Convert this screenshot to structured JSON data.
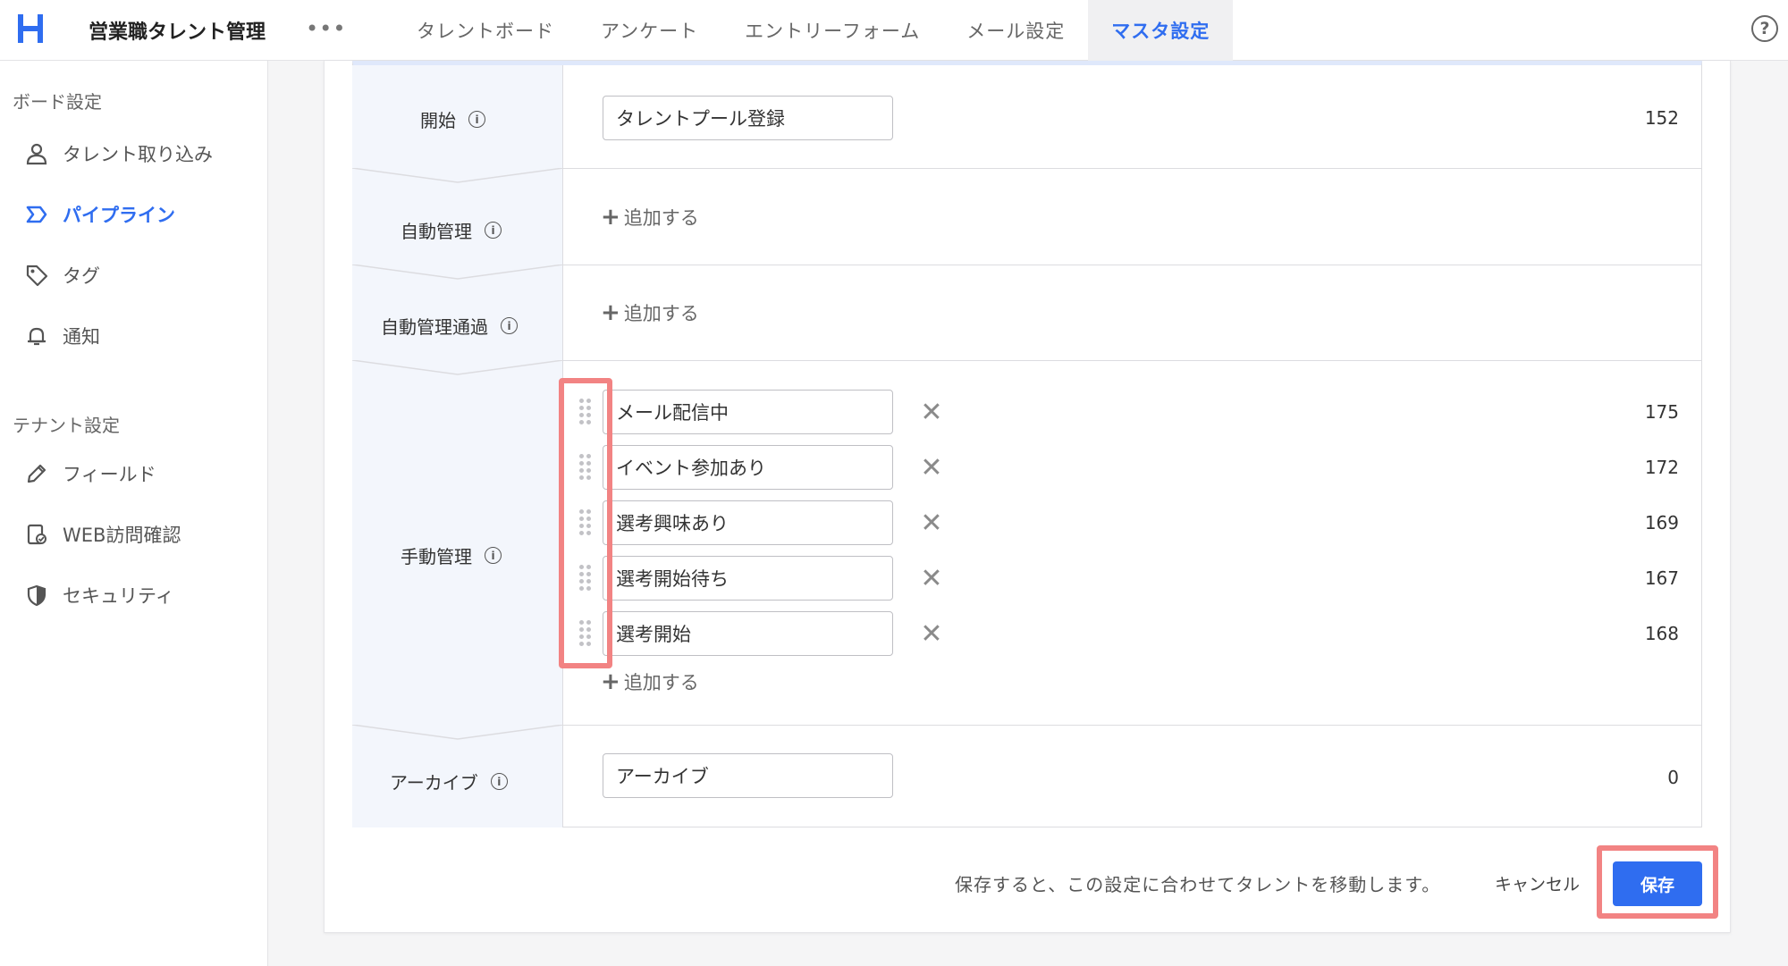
{
  "header": {
    "app_title": "営業職タレント管理",
    "more_label": "•••",
    "tabs": [
      {
        "label": "タレントボード"
      },
      {
        "label": "アンケート"
      },
      {
        "label": "エントリーフォーム"
      },
      {
        "label": "メール設定"
      },
      {
        "label": "マスタ設定",
        "active": true
      }
    ],
    "help_label": "?"
  },
  "sidebar": {
    "board_section": "ボード設定",
    "board_items": [
      {
        "label": "タレント取り込み",
        "icon": "person-icon"
      },
      {
        "label": "パイプライン",
        "icon": "pipeline-icon",
        "active": true
      },
      {
        "label": "タグ",
        "icon": "tag-icon"
      },
      {
        "label": "通知",
        "icon": "bell-icon"
      }
    ],
    "tenant_section": "テナント設定",
    "tenant_items": [
      {
        "label": "フィールド",
        "icon": "pencil-icon"
      },
      {
        "label": "WEB訪問確認",
        "icon": "web-visit-icon"
      },
      {
        "label": "セキュリティ",
        "icon": "shield-icon"
      }
    ]
  },
  "pipeline": {
    "start": {
      "label": "開始",
      "value": "タレントプール登録",
      "count": "152"
    },
    "auto": {
      "label": "自動管理",
      "add_label": "追加する"
    },
    "auto_pass": {
      "label": "自動管理通過",
      "add_label": "追加する"
    },
    "manual": {
      "label": "手動管理",
      "items": [
        {
          "value": "メール配信中",
          "count": "175"
        },
        {
          "value": "イベント参加あり",
          "count": "172"
        },
        {
          "value": "選考興味あり",
          "count": "169"
        },
        {
          "value": "選考開始待ち",
          "count": "167"
        },
        {
          "value": "選考開始",
          "count": "168"
        }
      ],
      "add_label": "追加する"
    },
    "archive": {
      "label": "アーカイブ",
      "value": "アーカイブ",
      "count": "0"
    },
    "info_glyph": "i",
    "remove_glyph": "✕",
    "plus_glyph": "+"
  },
  "footer": {
    "note": "保存すると、この設定に合わせてタレントを移動します。",
    "cancel_label": "キャンセル",
    "save_label": "保存"
  },
  "colors": {
    "accent": "#2f6df0",
    "highlight": "#f28383",
    "label_bg": "#f3f6fc"
  }
}
